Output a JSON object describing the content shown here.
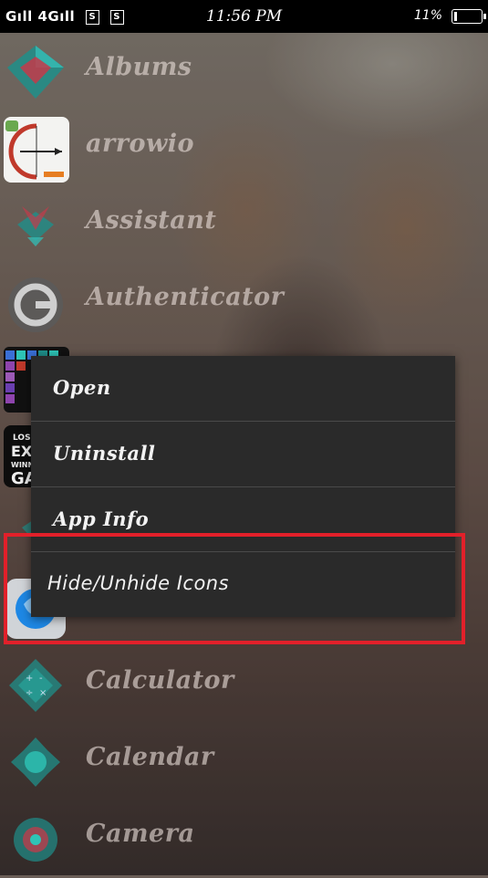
{
  "status_bar": {
    "signal_text": "Gıll 4Gıll",
    "sim1": "S",
    "sim2": "S",
    "time": "11:56 PM",
    "battery_text": "11%",
    "battery_level": 0.11
  },
  "apps": [
    {
      "label": "Albums",
      "icon": "albums-icon"
    },
    {
      "label": "arrowio",
      "icon": "arrowio-icon"
    },
    {
      "label": "Assistant",
      "icon": "assistant-icon"
    },
    {
      "label": "Authenticator",
      "icon": "authenticator-icon"
    },
    {
      "label": "",
      "icon": "colorful-grid-icon"
    },
    {
      "label": "",
      "icon": "game-icon"
    },
    {
      "label": "",
      "icon": "app-icon"
    },
    {
      "label": "",
      "icon": "browser-icon"
    },
    {
      "label": "Calculator",
      "icon": "calculator-icon"
    },
    {
      "label": "Calendar",
      "icon": "calendar-icon"
    },
    {
      "label": "Camera",
      "icon": "camera-icon"
    }
  ],
  "game_icon_text": [
    "LOSE",
    "EXC",
    "WINNE",
    "GA"
  ],
  "context_menu": {
    "items": [
      {
        "label": "Open"
      },
      {
        "label": "Uninstall"
      },
      {
        "label": "App Info"
      },
      {
        "label": "Hide/Unhide Icons"
      }
    ]
  },
  "colors": {
    "menu_bg": "#2a2a2a",
    "highlight": "#e2202a",
    "status_bar_bg": "#000000"
  }
}
